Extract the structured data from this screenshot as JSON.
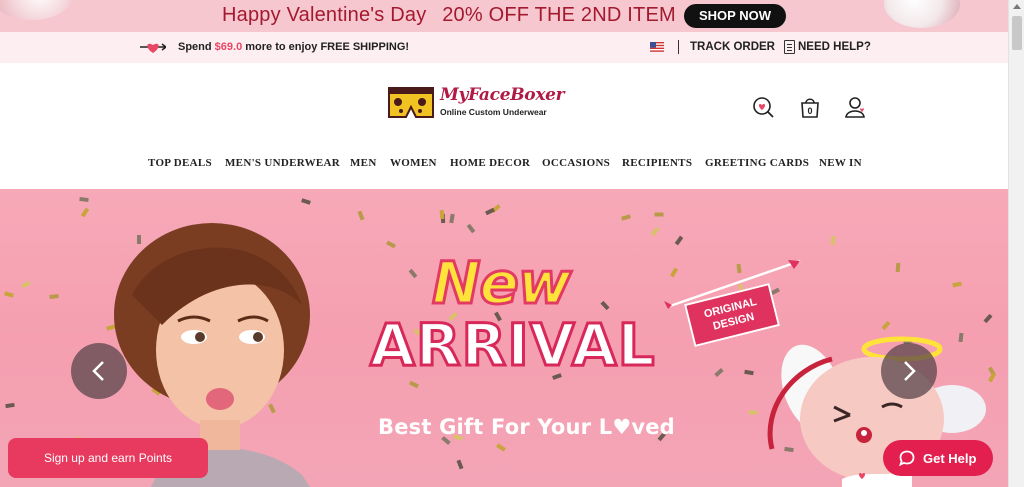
{
  "promo": {
    "text": "Happy Valentine's Day",
    "discount": "20% OFF THE 2ND ITEM",
    "cta": "SHOP NOW"
  },
  "shipping": {
    "prefix": "Spend ",
    "amount": "$69.0",
    "suffix": " more to enjoy FREE SHIPPING!",
    "track": "TRACK ORDER",
    "help": "NEED HELP?"
  },
  "logo": {
    "brand": "MyFaceBoxer",
    "tagline": "Online Custom Underwear"
  },
  "header_icons": [
    "wishlist-heart-icon",
    "cart-icon",
    "account-icon"
  ],
  "cart": {
    "count": "0"
  },
  "nav": [
    "TOP DEALS",
    "MEN'S UNDERWEAR",
    "MEN",
    "WOMEN",
    "HOME DECOR",
    "OCCASIONS",
    "RECIPIENTS",
    "GREETING CARDS",
    "NEW IN"
  ],
  "hero": {
    "new": "New",
    "arrival": "ARRIVAL",
    "sub": "Best Gift For Your L♥ved",
    "badge_line1": "ORIGINAL",
    "badge_line2": "DESIGN"
  },
  "floating": {
    "signup": "Sign up and earn Points",
    "gethelp": "Get Help"
  },
  "colors": {
    "accent": "#e83a5f",
    "promo_bg": "#f7c7cf",
    "promo_text": "#a3192f",
    "hero_bg": "#f7a9b8"
  }
}
